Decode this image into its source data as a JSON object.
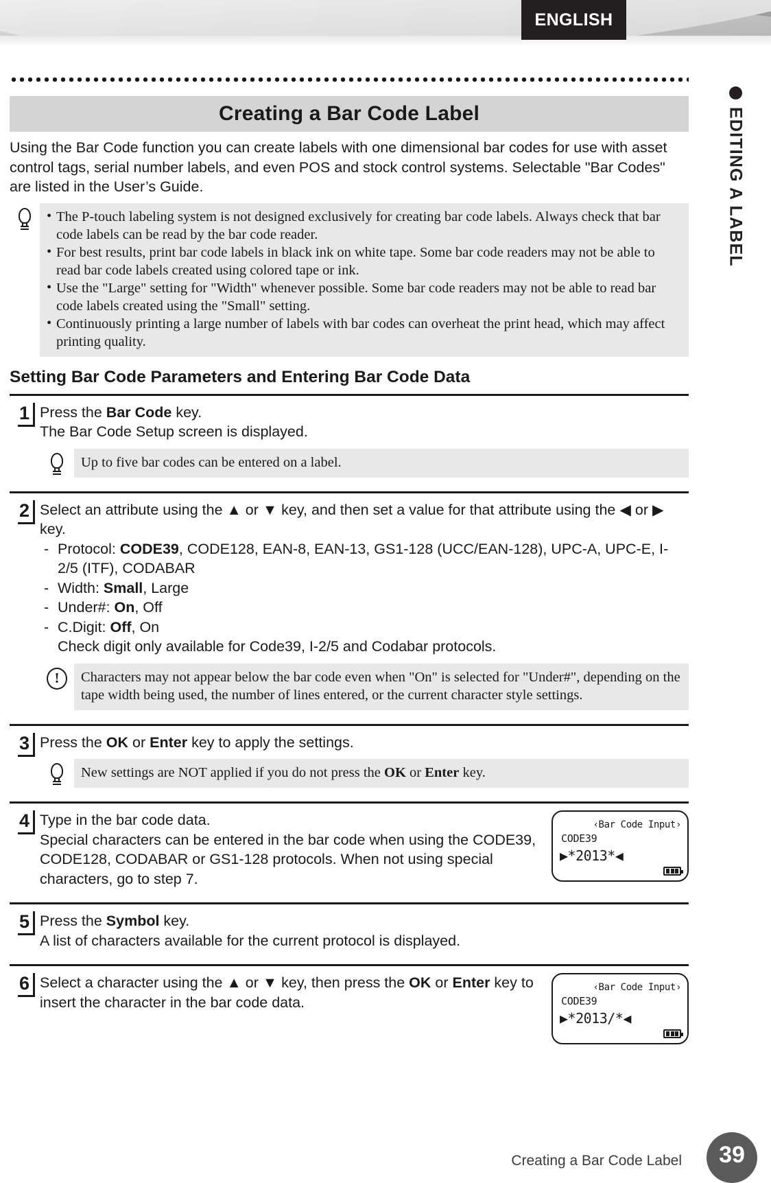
{
  "header": {
    "language_tab": "ENGLISH",
    "side_tab_label": "EDITING A LABEL"
  },
  "title": "Creating a Bar Code Label",
  "intro": "Using the Bar Code function you can create labels with one dimensional bar codes for use with asset control tags, serial number labels, and even POS and stock control systems. Selectable \"Bar Codes\" are listed in the User’s Guide.",
  "intro_note": {
    "icon": "bulb-icon",
    "items": [
      "The P-touch labeling system is not designed exclusively for creating bar code labels. Always check that bar code labels can be read by the bar code reader.",
      "For best results, print bar code labels in black ink on white tape. Some bar code readers may not be able to read bar code labels created using colored tape or ink.",
      "Use the \"Large\" setting for \"Width\" whenever possible. Some bar code readers may not be able to read bar code labels created using the \"Small\" setting.",
      "Continuously printing a large number of labels with bar codes can overheat the print head, which may affect printing quality."
    ]
  },
  "section_heading": "Setting Bar Code Parameters and Entering Bar Code Data",
  "steps": [
    {
      "number": "1",
      "line1_pre": "Press the ",
      "line1_bold": "Bar Code",
      "line1_post": " key.",
      "line2": "The Bar Code Setup screen is displayed.",
      "note": {
        "icon": "bulb-icon",
        "text": "Up to five bar codes can be entered on a label."
      }
    },
    {
      "number": "2",
      "line1_a": "Select an attribute using the ",
      "up_arrow": "▲",
      "line1_b": " or ",
      "down_arrow": "▼",
      "line1_c": " key, and then set a value for that attribute using the ",
      "left_arrow": "◀",
      "line1_d": " or ",
      "right_arrow": "▶",
      "line1_e": " key.",
      "attributes": [
        {
          "label": "Protocol: ",
          "default": "CODE39",
          "rest": ", CODE128, EAN-8, EAN-13, GS1-128 (UCC/EAN-128), UPC-A, UPC-E, I-2/5 (ITF), CODABAR"
        },
        {
          "label": "Width: ",
          "default": "Small",
          "rest": ", Large"
        },
        {
          "label": "Under#: ",
          "default": "On",
          "rest": ", Off"
        },
        {
          "label": "C.Digit: ",
          "default": "Off",
          "rest": ", On"
        }
      ],
      "attributes_footnote": "Check digit only available for Code39, I-2/5 and Codabar protocols.",
      "note": {
        "icon": "warning-icon",
        "text": "Characters may not appear below the bar code even when \"On\" is selected for \"Under#\", depending on the tape width being used, the number of lines entered, or the current character style settings."
      }
    },
    {
      "number": "3",
      "line1_pre": "Press the ",
      "line1_bold": "OK",
      "line1_mid": " or ",
      "line1_bold2": "Enter",
      "line1_post": " key to apply the settings.",
      "note": {
        "icon": "bulb-icon",
        "pre": "New settings are NOT applied if you do not press the ",
        "bold1": "OK",
        "mid": " or ",
        "bold2": "Enter",
        "post": " key."
      }
    },
    {
      "number": "4",
      "line1": "Type in the bar code data.",
      "line2": "Special characters can be entered in the bar code when using the CODE39, CODE128, CODABAR or GS1-128 protocols. When not using special characters, go to step 7.",
      "lcd": {
        "title": "‹Bar Code Input›",
        "protocol": "CODE39",
        "data": "▶*2013*◀",
        "battery": "battery-icon"
      }
    },
    {
      "number": "5",
      "line1_pre": "Press the ",
      "line1_bold": "Symbol",
      "line1_post": " key.",
      "line2": "A list of characters available for the current protocol is displayed."
    },
    {
      "number": "6",
      "line1_a": "Select a character using the ",
      "up_arrow": "▲",
      "line1_b": " or ",
      "down_arrow": "▼",
      "line1_c": " key, then press the ",
      "bold_ok": "OK",
      "line1_d": " or ",
      "bold_enter": "Enter",
      "line1_e": " key to insert the character in the bar code data.",
      "lcd": {
        "title": "‹Bar Code Input›",
        "protocol": "CODE39",
        "data": "▶*2013/*◀",
        "battery": "battery-icon"
      }
    }
  ],
  "footer": {
    "title": "Creating a Bar Code Label",
    "page_number": "39"
  }
}
